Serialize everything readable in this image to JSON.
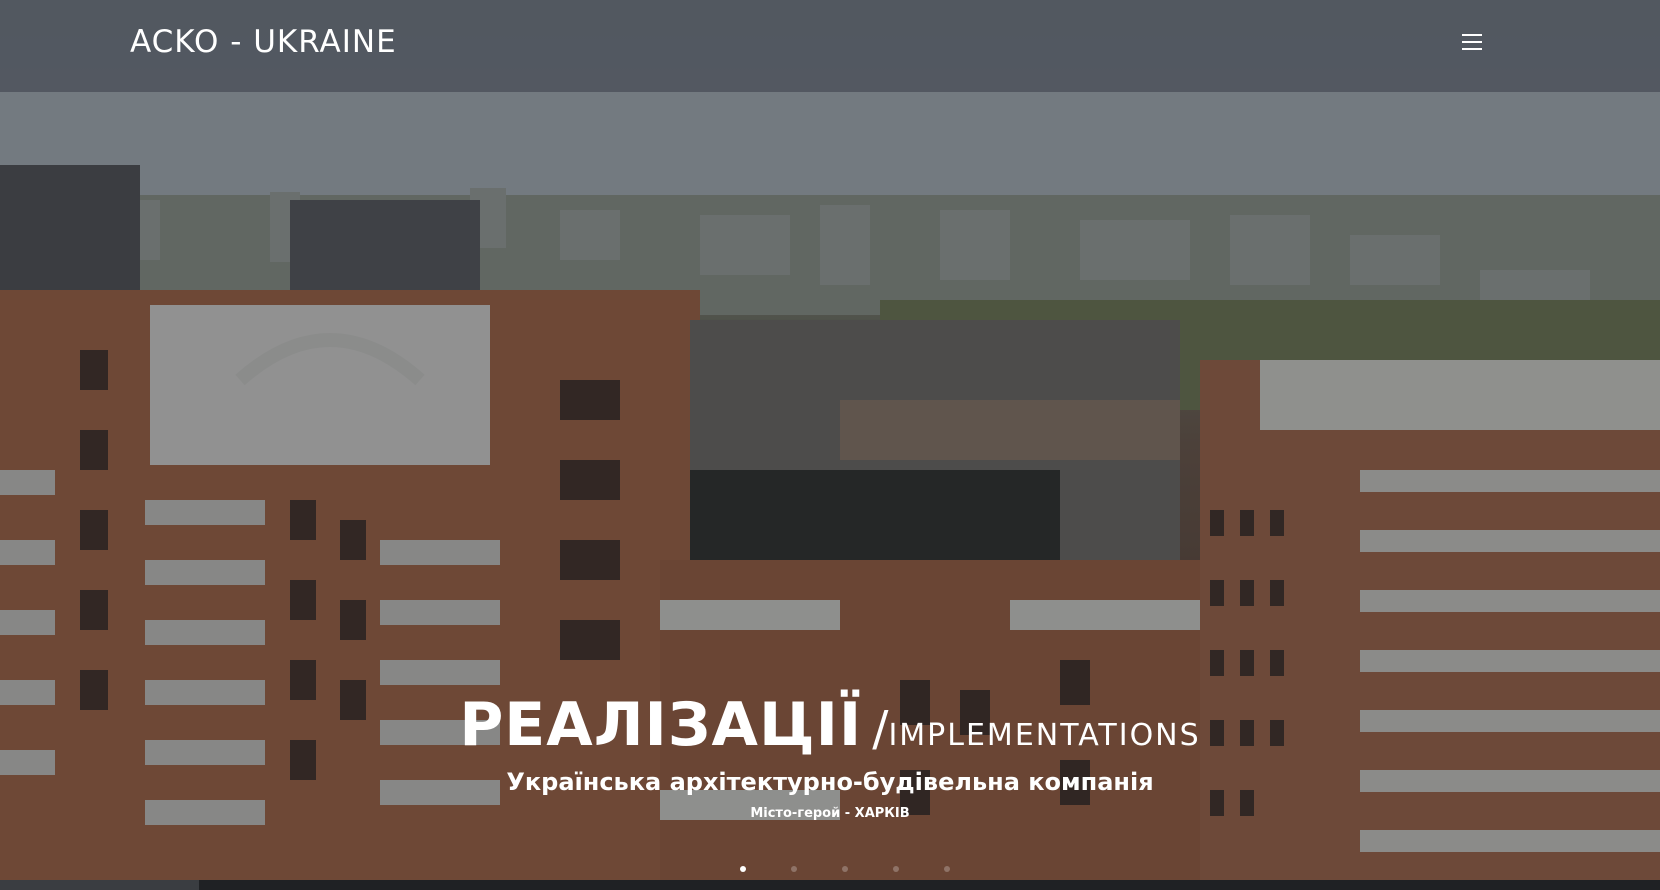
{
  "header": {
    "brand": "ACKO - UKRAINE",
    "menu_icon": "hamburger-menu-icon"
  },
  "hero": {
    "title_main": "РЕАЛІЗАЦІЇ",
    "title_slash": "/",
    "title_secondary": "IMPLEMENTATIONS",
    "subtitle": "Українська архітектурно-будівельна компанія",
    "city": "Місто-герой - ХАРКІВ"
  },
  "slider": {
    "slides": [
      {
        "active": true
      },
      {
        "active": false
      },
      {
        "active": false
      },
      {
        "active": false
      },
      {
        "active": false
      }
    ],
    "progress": 0.12
  },
  "colors": {
    "header_bg": "#50565e",
    "text": "#ffffff",
    "brick": "#b0694a"
  }
}
